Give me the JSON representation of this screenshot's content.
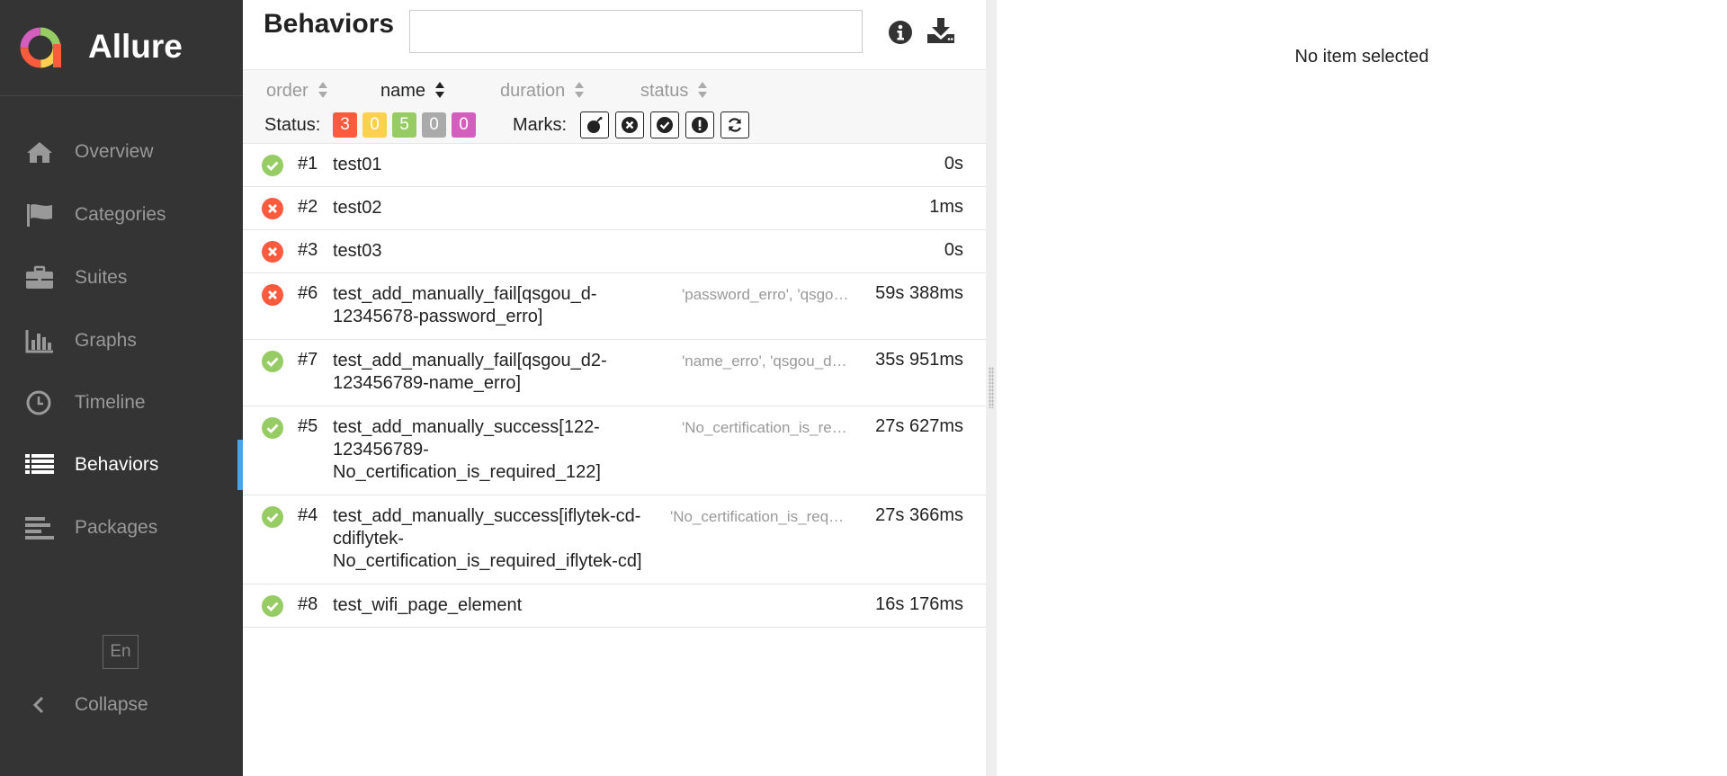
{
  "app": {
    "name": "Allure"
  },
  "sidebar": {
    "items": [
      {
        "label": "Overview",
        "icon": "home-icon"
      },
      {
        "label": "Categories",
        "icon": "flag-icon"
      },
      {
        "label": "Suites",
        "icon": "briefcase-icon"
      },
      {
        "label": "Graphs",
        "icon": "bar-chart-icon"
      },
      {
        "label": "Timeline",
        "icon": "clock-icon"
      },
      {
        "label": "Behaviors",
        "icon": "list-icon",
        "active": true
      },
      {
        "label": "Packages",
        "icon": "align-left-icon"
      }
    ],
    "language": "En",
    "collapse_label": "Collapse"
  },
  "tree": {
    "title": "Behaviors",
    "search": {
      "value": "",
      "placeholder": ""
    },
    "sorters": [
      "order",
      "name",
      "duration",
      "status"
    ],
    "active_sorter": "name",
    "status_label": "Status:",
    "status_counts": [
      {
        "status": "failed",
        "count": "3",
        "color": "#fd5a3e"
      },
      {
        "status": "broken",
        "count": "0",
        "color": "#ffd050"
      },
      {
        "status": "passed",
        "count": "5",
        "color": "#97cc64"
      },
      {
        "status": "skipped",
        "count": "0",
        "color": "#aaaaaa"
      },
      {
        "status": "unknown",
        "count": "0",
        "color": "#d35ebe"
      }
    ],
    "marks_label": "Marks:",
    "marks": [
      "bomb-icon",
      "times-circle-icon",
      "check-circle-icon",
      "exclamation-circle-icon",
      "refresh-icon"
    ],
    "rows": [
      {
        "status": "passed",
        "order": "#1",
        "name": "test01",
        "params": "",
        "duration": "0s"
      },
      {
        "status": "failed",
        "order": "#2",
        "name": "test02",
        "params": "",
        "duration": "1ms"
      },
      {
        "status": "failed",
        "order": "#3",
        "name": "test03",
        "params": "",
        "duration": "0s"
      },
      {
        "status": "failed",
        "order": "#6",
        "name": "test_add_manually_fail[qsgou_d-\n12345678-password_erro]",
        "params": "'password_erro', 'qsgo…",
        "duration": "59s 388ms"
      },
      {
        "status": "passed",
        "order": "#7",
        "name": "test_add_manually_fail[qsgou_d2-\n123456789-name_erro]",
        "params": "'name_erro', 'qsgou_d…",
        "duration": "35s 951ms"
      },
      {
        "status": "passed",
        "order": "#5",
        "name": "test_add_manually_success[122-\n123456789-\nNo_certification_is_required_122]",
        "params": "'No_certification_is_re…",
        "duration": "27s 627ms"
      },
      {
        "status": "passed",
        "order": "#4",
        "name": "test_add_manually_success[iflytek-cd-\ncdiflytek-\nNo_certification_is_required_iflytek-cd]",
        "params": "'No_certification_is_req…",
        "duration": "27s 366ms"
      },
      {
        "status": "passed",
        "order": "#8",
        "name": "test_wifi_page_element",
        "params": "",
        "duration": "16s 176ms"
      }
    ]
  },
  "detail": {
    "empty_message": "No item selected"
  },
  "colors": {
    "passed": "#97cc64",
    "failed": "#fd5a3e",
    "sidebar_bg": "#343434",
    "active_accent": "#4fa3e0"
  }
}
